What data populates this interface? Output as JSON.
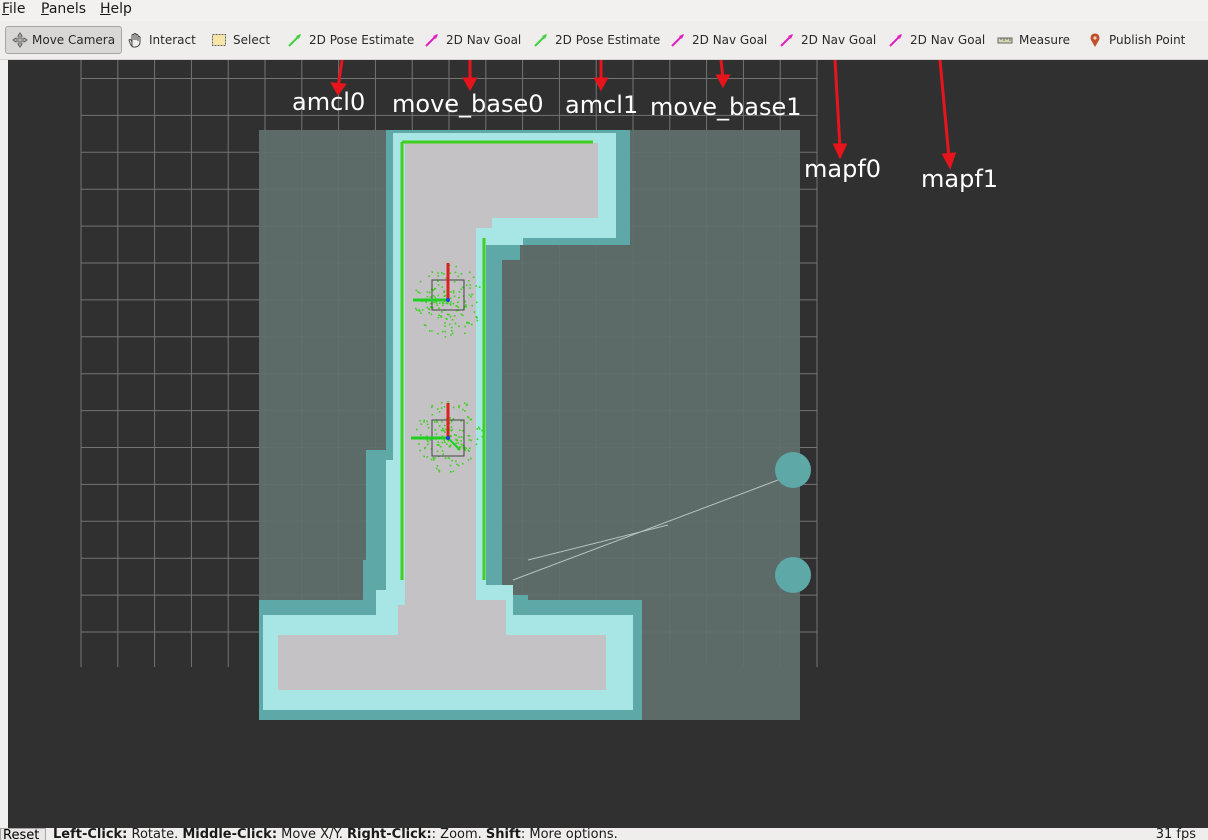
{
  "menubar": {
    "items": [
      {
        "label": "File",
        "mnemonic": "F",
        "rest": "ile"
      },
      {
        "label": "Panels",
        "mnemonic": "P",
        "rest": "anels"
      },
      {
        "label": "Help",
        "mnemonic": "H",
        "rest": "elp"
      }
    ]
  },
  "toolbar": {
    "tools": [
      {
        "label": "Move Camera",
        "icon": "move-camera-icon",
        "active": true
      },
      {
        "label": "Interact",
        "icon": "hand-icon"
      },
      {
        "label": "Select",
        "icon": "select-box-icon"
      },
      {
        "label": "2D Pose Estimate",
        "icon": "green-arrow-icon",
        "color": "#3fd13f"
      },
      {
        "label": "2D Nav Goal",
        "icon": "magenta-arrow-icon",
        "color": "#e020c0"
      },
      {
        "label": "2D Pose Estimate",
        "icon": "green-arrow-icon",
        "color": "#3fd13f"
      },
      {
        "label": "2D Nav Goal",
        "icon": "magenta-arrow-icon",
        "color": "#e020c0"
      },
      {
        "label": "2D Nav Goal",
        "icon": "magenta-arrow-icon",
        "color": "#e020c0"
      },
      {
        "label": "2D Nav Goal",
        "icon": "magenta-arrow-icon",
        "color": "#e020c0"
      },
      {
        "label": "Measure",
        "icon": "ruler-icon"
      },
      {
        "label": "Publish Point",
        "icon": "map-pin-icon",
        "color": "#c0502a"
      }
    ]
  },
  "annotations": {
    "amcl0": "amcl0",
    "move_base0": "move_base0",
    "amcl1": "amcl1",
    "move_base1": "move_base1",
    "mapf0": "mapf0",
    "mapf1": "mapf1",
    "arrow_color": "#e8141c"
  },
  "status": {
    "reset_label": "Reset",
    "hint_left_key": "Left-Click:",
    "hint_left": " Rotate. ",
    "hint_middle_key": "Middle-Click:",
    "hint_middle": " Move X/Y. ",
    "hint_right_key": "Right-Click:",
    "hint_right": ": Zoom. ",
    "hint_shift_key": "Shift",
    "hint_shift": ": More options.",
    "fps": "31 fps"
  },
  "colors": {
    "background": "#303030",
    "grid": "#8a8a8a",
    "map_unknown": "#5f6e6b",
    "inflation": "#5fa8a8",
    "cost_inner": "#a8e6e6",
    "free_space": "#c4c2c4",
    "laser": "#40d020",
    "axis_red": "#e02020",
    "axis_green": "#20d020",
    "axis_blue": "#2040e0"
  }
}
